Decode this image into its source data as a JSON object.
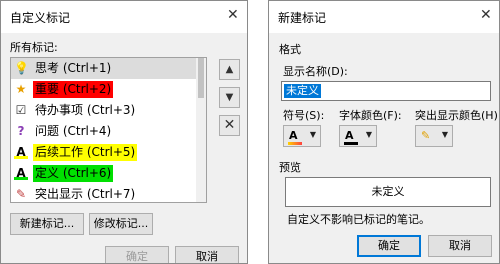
{
  "left_dialog": {
    "title": "自定义标记",
    "close": "✕",
    "all_tags_label": "所有标记:",
    "tags": [
      {
        "label": "思考 (Ctrl+1)",
        "icon": "lightbulb-icon",
        "glyph": "💡",
        "highlight": "",
        "selected": true
      },
      {
        "label": "重要 (Ctrl+2)",
        "icon": "star-icon",
        "glyph": "★",
        "highlight": "#ff0000",
        "selected": false
      },
      {
        "label": "待办事项 (Ctrl+3)",
        "icon": "checkbox-icon",
        "glyph": "☑",
        "highlight": "",
        "selected": false
      },
      {
        "label": "问题 (Ctrl+4)",
        "icon": "question-icon",
        "glyph": "?",
        "highlight": "",
        "selected": false
      },
      {
        "label": "后续工作 (Ctrl+5)",
        "icon": "font-color-a-icon",
        "glyph": "A",
        "highlight": "#ffff00",
        "selected": false
      },
      {
        "label": "定义 (Ctrl+6)",
        "icon": "font-color-a-icon",
        "glyph": "A",
        "highlight": "#00e000",
        "selected": false
      },
      {
        "label": "突出显示 (Ctrl+7)",
        "icon": "pen-icon",
        "glyph": "✎",
        "highlight": "",
        "selected": false
      }
    ],
    "side_buttons": {
      "up": "▲",
      "down": "▼",
      "delete": "✕"
    },
    "new_tag_button": "新建标记...",
    "modify_tag_button": "修改标记...",
    "ok_button": "确定",
    "cancel_button": "取消"
  },
  "right_dialog": {
    "title": "新建标记",
    "close": "✕",
    "format_label": "格式",
    "display_name_label": "显示名称(D):",
    "display_name_value": "未定义",
    "symbol_label": "符号(S):",
    "font_color_label": "字体颜色(F):",
    "highlight_color_label": "突出显示颜色(H):",
    "dropdown_glyph": "▼",
    "preview_label": "预览",
    "preview_text": "未定义",
    "note": "自定义不影响已标记的笔记。",
    "ok_button": "确定",
    "cancel_button": "取消"
  },
  "colors": {
    "accent": "#0078d7",
    "red": "#ff0000",
    "yellow": "#ffff00",
    "green": "#00e000"
  }
}
